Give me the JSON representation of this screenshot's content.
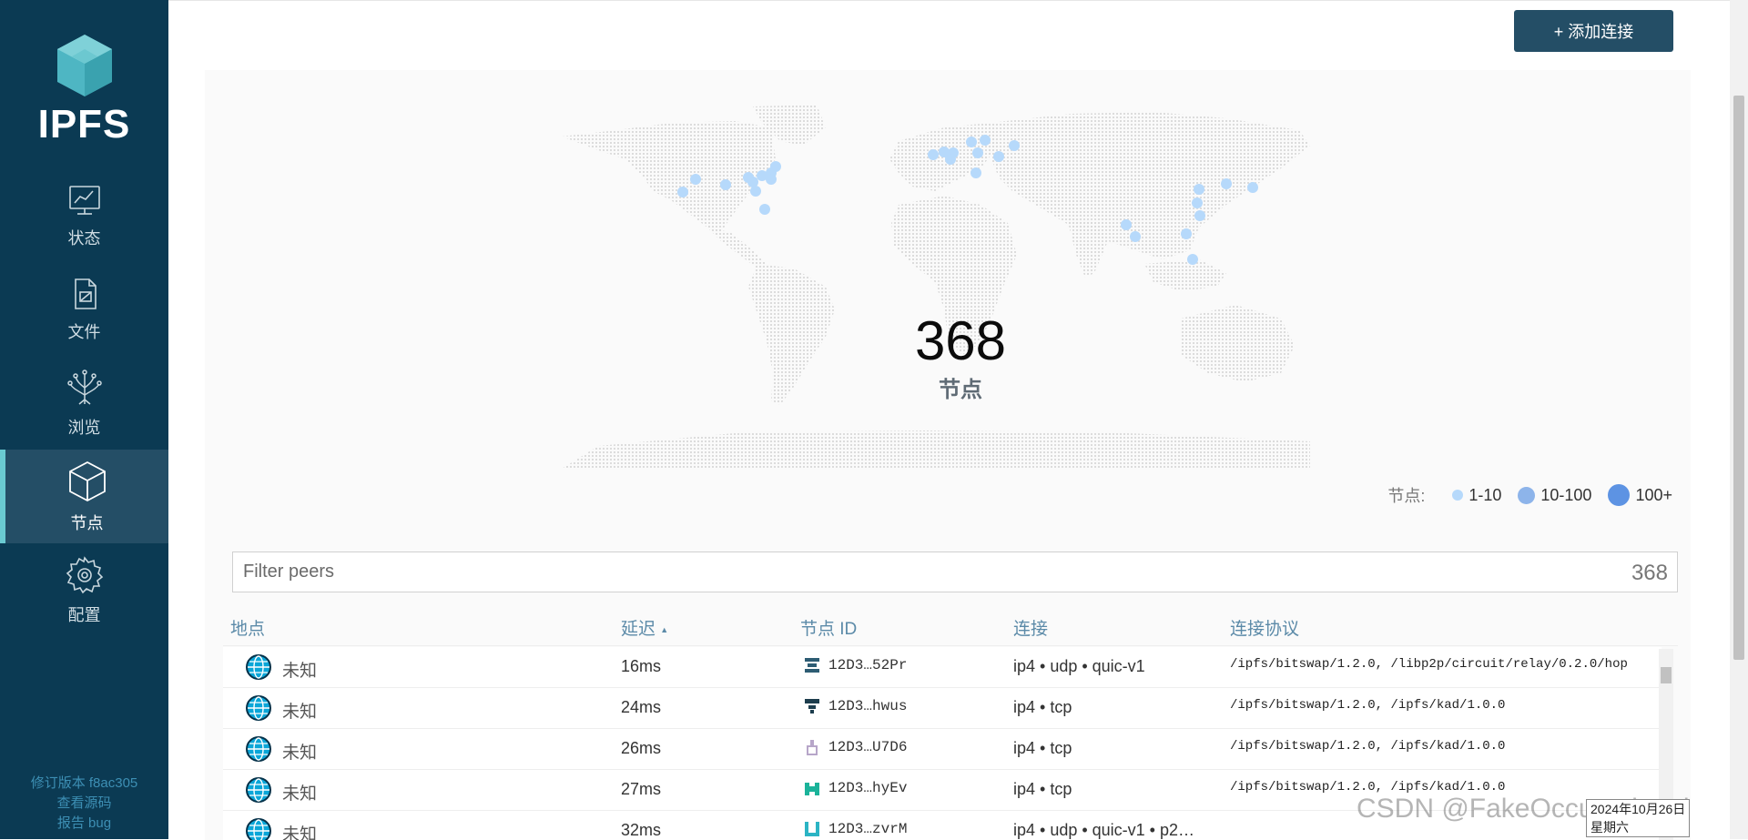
{
  "sidebar": {
    "logo_text": "IPFS",
    "items": [
      {
        "label": "状态",
        "icon": "status-chart-icon"
      },
      {
        "label": "文件",
        "icon": "files-icon"
      },
      {
        "label": "浏览",
        "icon": "explore-tree-icon"
      },
      {
        "label": "节点",
        "icon": "peers-cube-icon",
        "active": true
      },
      {
        "label": "配置",
        "icon": "settings-gear-icon"
      }
    ],
    "footer": {
      "revision": "修订版本 f8ac305",
      "source": "查看源码",
      "report": "报告 bug"
    }
  },
  "header": {
    "add_button": "+ 添加连接"
  },
  "map": {
    "peer_count": "368",
    "peer_count_label": "节点",
    "legend": {
      "label": "节点:",
      "items": [
        {
          "label": "1-10",
          "color": "#b6d9fb"
        },
        {
          "label": "10-100",
          "color": "#8db4ea"
        },
        {
          "label": "100+",
          "color": "#5d93e3"
        }
      ]
    }
  },
  "filter": {
    "placeholder": "Filter peers",
    "count": "368"
  },
  "table": {
    "columns": [
      "地点",
      "延迟",
      "节点 ID",
      "连接",
      "连接协议"
    ],
    "sort_indicator": "▲",
    "rows": [
      {
        "location": "未知",
        "latency": "16ms",
        "peer_id": "12D3…52Pr",
        "connection": "ip4 • udp • quic-v1",
        "protocols": "/ipfs/bitswap/1.2.0, /libp2p/circuit/relay/0.2.0/hop"
      },
      {
        "location": "未知",
        "latency": "24ms",
        "peer_id": "12D3…hwus",
        "connection": "ip4 • tcp",
        "protocols": "/ipfs/bitswap/1.2.0, /ipfs/kad/1.0.0"
      },
      {
        "location": "未知",
        "latency": "26ms",
        "peer_id": "12D3…U7D6",
        "connection": "ip4 • tcp",
        "protocols": "/ipfs/bitswap/1.2.0, /ipfs/kad/1.0.0"
      },
      {
        "location": "未知",
        "latency": "27ms",
        "peer_id": "12D3…hyEv",
        "connection": "ip4 • tcp",
        "protocols": "/ipfs/bitswap/1.2.0, /ipfs/kad/1.0.0"
      },
      {
        "location": "未知",
        "latency": "32ms",
        "peer_id": "12D3…zvrM",
        "connection": "ip4 • udp • quic-v1 • p2…",
        "protocols": ""
      }
    ]
  },
  "overlay": {
    "watermark": "CSDN @FakeOccupational",
    "date": "2024年10月26日",
    "weekday": "星期六"
  }
}
